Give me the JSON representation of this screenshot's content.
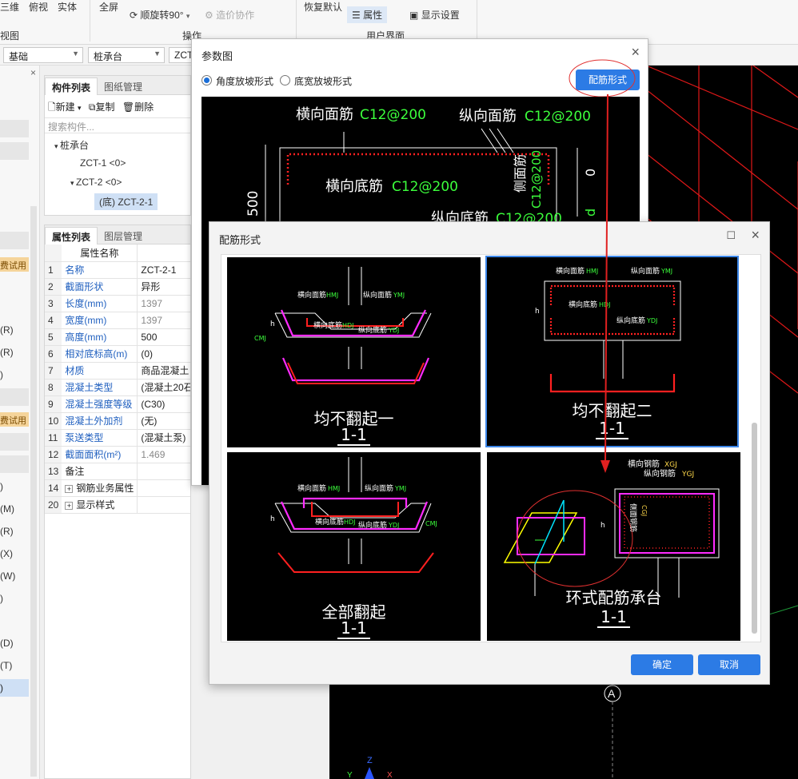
{
  "ribbon": {
    "view_3d": "三维",
    "view_top": "俯视",
    "view_solid": "实体",
    "fullscreen": "全屏",
    "rotate90": "顺旋转90°",
    "cost_collab": "造价协作",
    "restore_default": "恢复默认",
    "properties": "属性",
    "display_settings": "显示设置",
    "group_view": "视图",
    "group_operation": "操作",
    "group_ui": "用户界面"
  },
  "selectors": {
    "floor": "基础",
    "type": "桩承台",
    "component": "ZCT-"
  },
  "left_strip": {
    "items": [
      "(R)",
      "(R)",
      ")",
      ")",
      "(M)",
      "(R)",
      "(X)",
      "(W)",
      ")",
      "(D)",
      "(T)",
      ")"
    ],
    "badges": [
      "费试用",
      "费试用"
    ]
  },
  "component_panel": {
    "tabs": [
      "构件列表",
      "图纸管理"
    ],
    "toolbar": {
      "new": "新建",
      "copy": "复制",
      "delete": "删除"
    },
    "search_placeholder": "搜索构件...",
    "tree": {
      "root": "桩承台",
      "item1": "ZCT-1 <0>",
      "item2": "ZCT-2 <0>",
      "child": "(底) ZCT-2-1"
    }
  },
  "property_panel": {
    "tabs": [
      "属性列表",
      "图层管理"
    ],
    "header": "属性名称",
    "rows": [
      {
        "n": "1",
        "name": "名称",
        "value": "ZCT-2-1"
      },
      {
        "n": "2",
        "name": "截面形状",
        "value": "异形"
      },
      {
        "n": "3",
        "name": "长度(mm)",
        "value": "1397"
      },
      {
        "n": "4",
        "name": "宽度(mm)",
        "value": "1397"
      },
      {
        "n": "5",
        "name": "高度(mm)",
        "value": "500"
      },
      {
        "n": "6",
        "name": "相对底标高(m)",
        "value": "(0)"
      },
      {
        "n": "7",
        "name": "材质",
        "value": "商品混凝土"
      },
      {
        "n": "8",
        "name": "混凝土类型",
        "value": "(混凝土20石"
      },
      {
        "n": "9",
        "name": "混凝土强度等级",
        "value": "(C30)"
      },
      {
        "n": "10",
        "name": "混凝土外加剂",
        "value": "(无)"
      },
      {
        "n": "11",
        "name": "泵送类型",
        "value": "(混凝土泵)"
      },
      {
        "n": "12",
        "name": "截面面积(m²)",
        "value": "1.469"
      },
      {
        "n": "13",
        "name": "备注",
        "value": ""
      },
      {
        "n": "14",
        "name": "钢筋业务属性",
        "value": ""
      },
      {
        "n": "20",
        "name": "显示样式",
        "value": ""
      }
    ]
  },
  "param_dialog": {
    "title": "参数图",
    "radio1": "角度放坡形式",
    "radio2": "底宽放坡形式",
    "rebar_button": "配筋形式",
    "labels": {
      "top_h": "横向面筋",
      "top_h_val": "C12@200",
      "top_v": "纵向面筋",
      "top_v_val": "C12@200",
      "bot_h": "横向底筋",
      "bot_h_val": "C12@200",
      "bot_v": "纵向底筋",
      "bot_v_val": "C12@200",
      "side": "侧面筋",
      "side_val": "C12@200",
      "height": "500",
      "zero": "0",
      "d": "d"
    }
  },
  "rebar_dialog": {
    "title": "配筋形式",
    "options": [
      {
        "caption": "均不翻起一",
        "section": "1-1"
      },
      {
        "caption": "均不翻起二",
        "section": "1-1"
      },
      {
        "caption": "全部翻起",
        "section": "1-1"
      },
      {
        "caption": "环式配筋承台",
        "section": "1-1"
      }
    ],
    "cad_labels": {
      "h_top": "横向面筋",
      "v_top": "纵向面筋",
      "h_bot": "横向底筋",
      "v_bot": "纵向底筋",
      "mj": "HMJ",
      "ymj": "YMJ",
      "hdj": "HDJ",
      "ydj": "YDJ",
      "cmj": "CMJ",
      "h_rebar": "横向钢筋",
      "v_rebar": "纵向钢筋",
      "xgj": "XGJ",
      "ygj": "YGJ",
      "side_rebar": "侧面钢筋",
      "cgj": "CGJ",
      "h": "h"
    },
    "ok": "确定",
    "cancel": "取消"
  },
  "canvas": {
    "axis_label": "A",
    "axis_x": "X",
    "axis_y": "Y",
    "axis_z": "Z"
  },
  "colors": {
    "accent": "#2c7be5",
    "cad_red": "#ff2020",
    "cad_green": "#3cff3c",
    "cad_magenta": "#ff2bff"
  }
}
